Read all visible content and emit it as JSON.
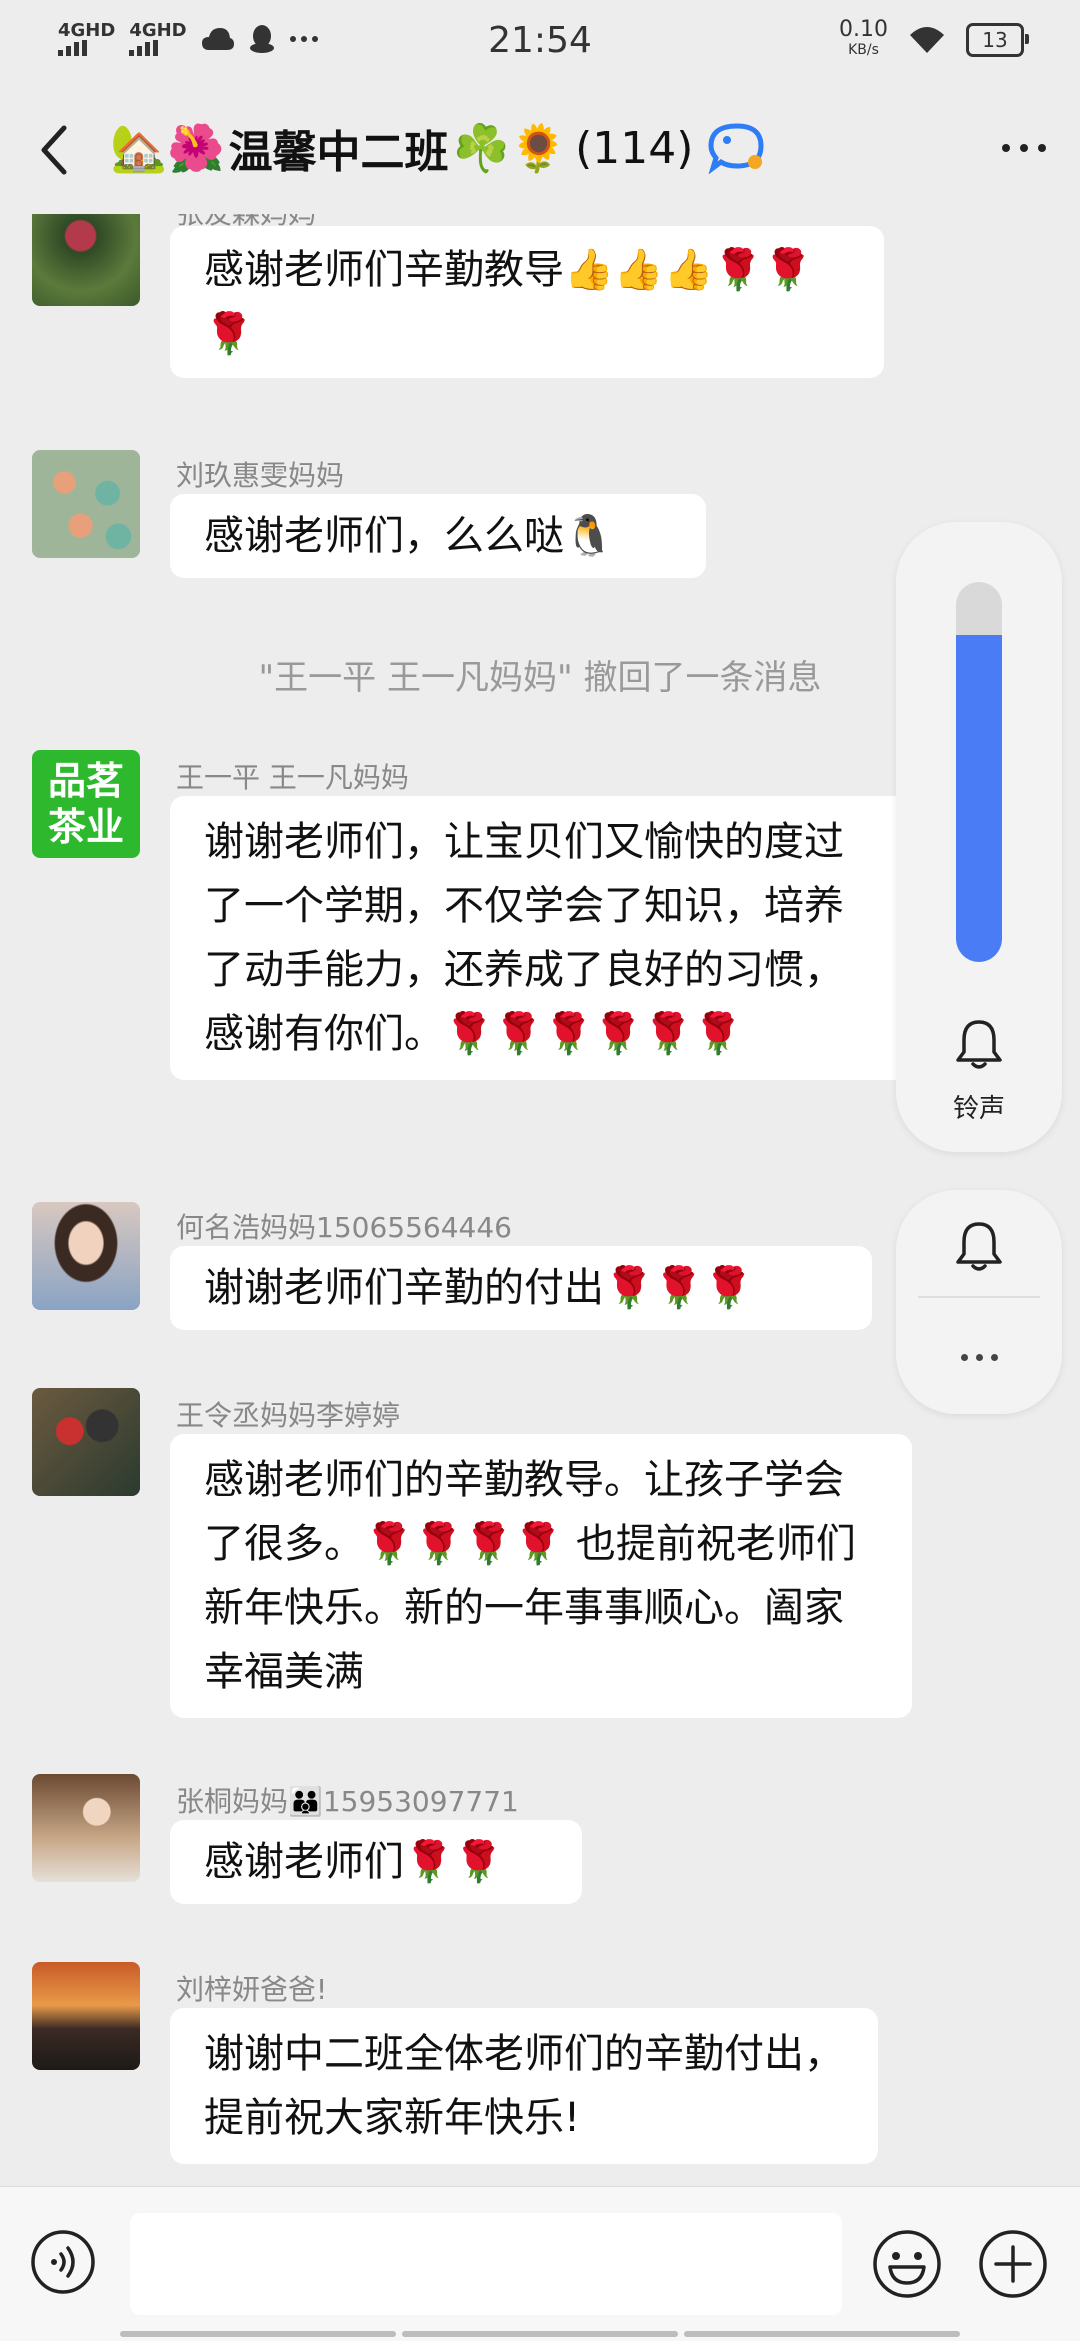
{
  "status_bar": {
    "net1": "4GHD",
    "net2": "4GHD",
    "time": "21:54",
    "speed_value": "0.10",
    "speed_unit": "KB/s",
    "battery": "13"
  },
  "header": {
    "emoji_prefix": "🏡🌺",
    "title": "温馨中二班",
    "emoji_suffix": "☘️🌻",
    "member_count": "(114)"
  },
  "messages": [
    {
      "sender": "张友森妈妈",
      "text": "感谢老师们辛勤教导👍👍👍🌹🌹🌹"
    },
    {
      "sender": "刘玖惠雯妈妈",
      "text": "感谢老师们，么么哒🐧"
    },
    {
      "system": "\"王一平  王一凡妈妈\" 撤回了一条消息"
    },
    {
      "sender": "王一平  王一凡妈妈",
      "text": "谢谢老师们，让宝贝们又愉快的度过了一个学期，不仅学会了知识，培养了动手能力，还养成了良好的习惯，感谢有你们。🌹🌹🌹🌹🌹🌹"
    },
    {
      "sender": "何名浩妈妈15065564446",
      "text": "谢谢老师们辛勤的付出🌹🌹🌹"
    },
    {
      "sender": "王令丞妈妈李婷婷",
      "text": "感谢老师们的辛勤教导。让孩子学会了很多。🌹🌹🌹🌹  也提前祝老师们新年快乐。新的一年事事顺心。阖家幸福美满"
    },
    {
      "sender": "张桐妈妈👪15953097771",
      "text": "感谢老师们🌹🌹"
    },
    {
      "sender": "刘梓妍爸爸!",
      "text": "谢谢中二班全体老师们的辛勤付出，提前祝大家新年快乐!"
    }
  ],
  "avatar_badge": {
    "line1": "品茗",
    "line2": "茶业"
  },
  "volume_panel": {
    "label": "铃声",
    "level": 0.86
  },
  "colors": {
    "accent": "#4a7cf6",
    "chat_bg": "#ededed",
    "badge_green": "#2db82d"
  },
  "icons": [
    "back-arrow-icon",
    "more-dots-icon",
    "bell-icon",
    "voice-icon",
    "emoji-icon",
    "plus-icon",
    "chat-bubble-icon"
  ]
}
